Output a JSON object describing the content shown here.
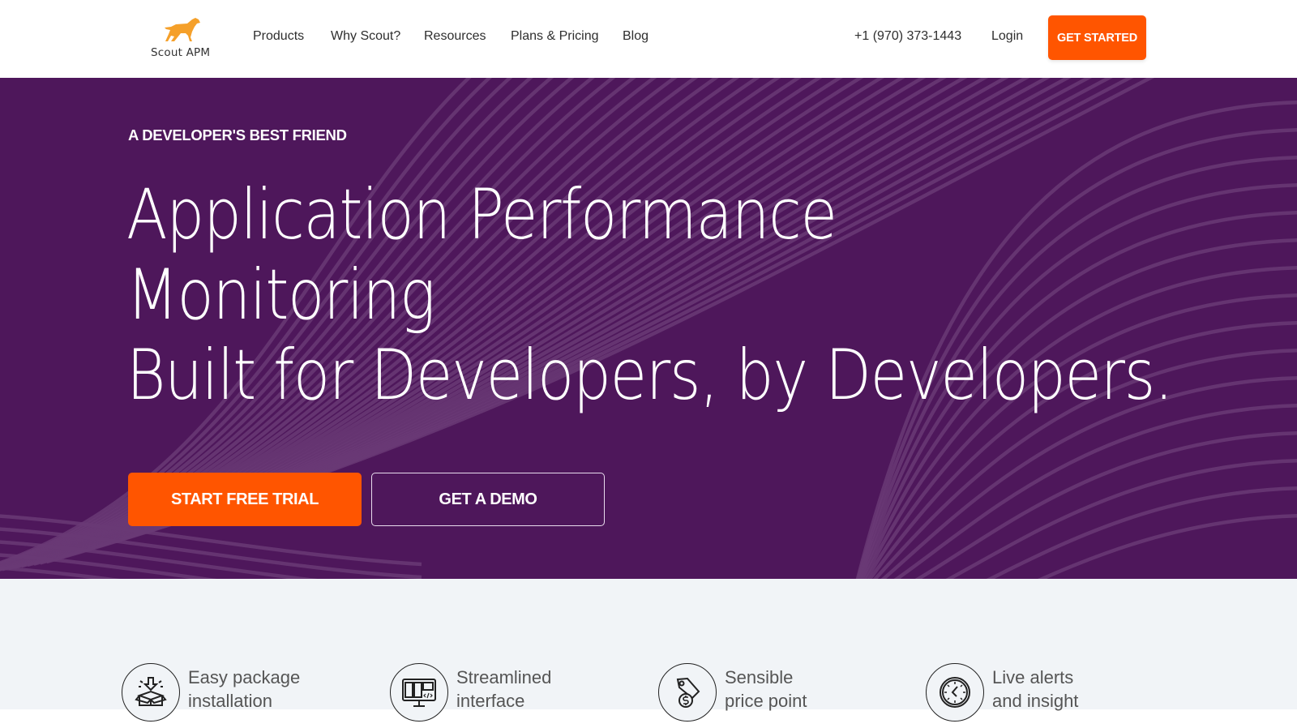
{
  "nav": {
    "logo_text": "Scout APM",
    "links": [
      "Products",
      "Why Scout?",
      "Resources",
      "Plans & Pricing",
      "Blog"
    ],
    "phone": "+1 (970) 373-1443",
    "login": "Login",
    "cta": "GET STARTED"
  },
  "hero": {
    "eyebrow": "A DEVELOPER'S BEST FRIEND",
    "headline": [
      "Application Performance",
      "Monitoring",
      "Built for Developers, by Developers."
    ],
    "primary_button": "START FREE TRIAL",
    "secondary_button": "GET A DEMO"
  },
  "features": [
    {
      "icon": "package-install-icon",
      "line1": "Easy package",
      "line2": "installation"
    },
    {
      "icon": "monitor-interface-icon",
      "line1": "Streamlined",
      "line2": "interface"
    },
    {
      "icon": "price-tag-icon",
      "line1": "Sensible",
      "line2": "price point"
    },
    {
      "icon": "clock-alert-icon",
      "line1": "Live alerts",
      "line2": "and insight"
    }
  ],
  "colors": {
    "brand_orange": "#ff5500",
    "hero_purple": "#4e175b",
    "features_bg": "#f1f4f7",
    "logo_dog": "#f5a02a"
  }
}
